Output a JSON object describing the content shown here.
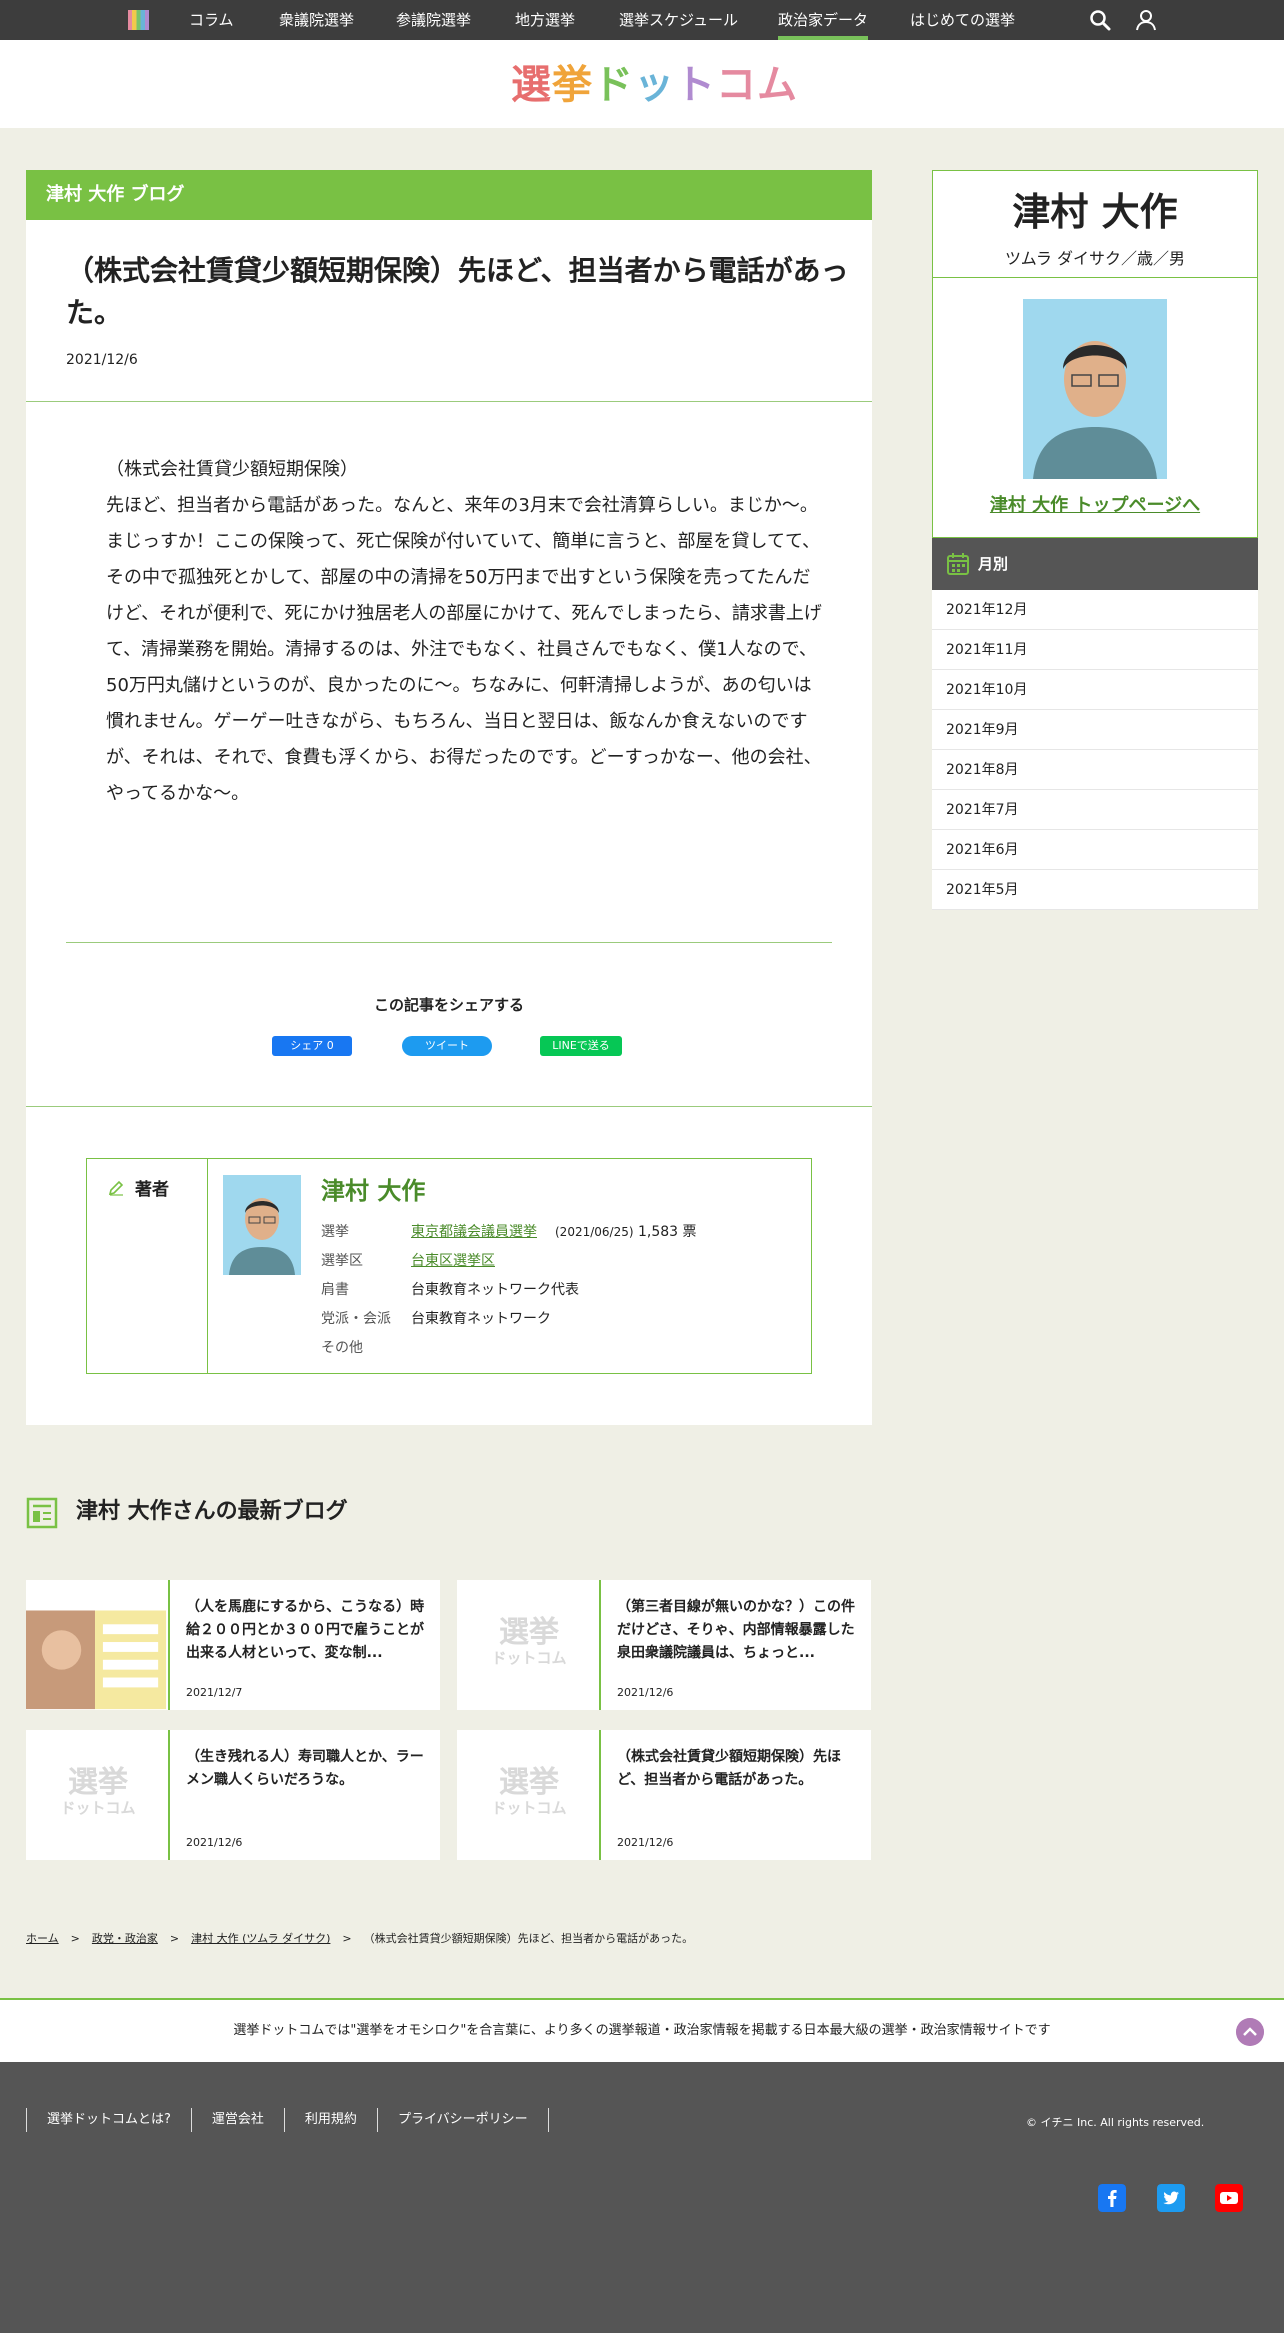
{
  "topnav": {
    "items": [
      "コラム",
      "衆議院選挙",
      "参議院選挙",
      "地方選挙",
      "選挙スケジュール",
      "政治家データ",
      "はじめての選挙"
    ],
    "active_index": 5,
    "accent_color": "#79c15a"
  },
  "logo": {
    "text": [
      "選",
      "挙",
      "ド",
      "ッ",
      "ト",
      "コム"
    ]
  },
  "article": {
    "header": "津村 大作 ブログ",
    "title": "（株式会社賃貸少額短期保険）先ほど、担当者から電話があった。",
    "date": "2021/12/6",
    "body": "（株式会社賃貸少額短期保険）\n先ほど、担当者から電話があった。なんと、来年の3月末で会社清算らしい。まじか～。まじっすか！ここの保険って、死亡保険が付いていて、簡単に言うと、部屋を貸してて、その中で孤独死とかして、部屋の中の清掃を50万円まで出すという保険を売ってたんだけど、それが便利で、死にかけ独居老人の部屋にかけて、死んでしまったら、請求書上げて、清掃業務を開始。清掃するのは、外注でもなく、社員さんでもなく、僕1人なので、50万円丸儲けというのが、良かったのに～。ちなみに、何軒清掃しようが、あの匂いは慣れません。ゲーゲー吐きながら、もちろん、当日と翌日は、飯なんか食えないのですが、それは、それで、食費も浮くから、お得だったのです。どーすっかなー、他の会社、やってるかな～。",
    "share_title": "この記事をシェアする",
    "share": {
      "fb": "シェア 0",
      "tw": "ツイート",
      "line": "LINEで送る"
    }
  },
  "author": {
    "label": "著者",
    "name": "津村 大作",
    "rows": {
      "election_key": "選挙",
      "election_link": "東京都議会議員選挙",
      "election_date": "(2021/06/25)",
      "election_votes": "1,583 票",
      "district_key": "選挙区",
      "district_link": "台東区選挙区",
      "title_key": "肩書",
      "title_val": "台東教育ネットワーク代表",
      "party_key": "党派・会派",
      "party_val": "台東教育ネットワーク",
      "other_key": "その他",
      "other_val": ""
    }
  },
  "profile": {
    "name": "津村 大作",
    "kana": "ツムラ ダイサク／歳／男",
    "top_link": "津村 大作 トップページへ"
  },
  "monthly": {
    "header": "月別",
    "items": [
      "2021年12月",
      "2021年11月",
      "2021年10月",
      "2021年9月",
      "2021年8月",
      "2021年7月",
      "2021年6月",
      "2021年5月"
    ]
  },
  "latest": {
    "title": "津村 大作さんの最新ブログ",
    "placeholder": [
      "選挙",
      "ドットコム"
    ],
    "cards": [
      {
        "title": "（人を馬鹿にするから、こうなる）時給２００円とか３００円で雇うことが出来る人材といって、変な制...",
        "date": "2021/12/7"
      },
      {
        "title": "（第三者目線が無いのかな？）この件だけどさ、そりゃ、内部情報暴露した泉田衆議院議員は、ちょっと...",
        "date": "2021/12/6"
      },
      {
        "title": "（生き残れる人）寿司職人とか、ラーメン職人くらいだろうな。",
        "date": "2021/12/6"
      },
      {
        "title": "（株式会社賃貸少額短期保険）先ほど、担当者から電話があった。",
        "date": "2021/12/6"
      }
    ]
  },
  "breadcrumb": [
    "ホーム",
    "政党・政治家",
    "津村 大作 (ツムラ ダイサク)",
    "（株式会社賃貸少額短期保険）先ほど、担当者から電話があった。"
  ],
  "tagline": "選挙ドットコムでは\"選挙をオモシロク\"を合言葉に、より多くの選挙報道・政治家情報を掲載する日本最大級の選挙・政治家情報サイトです",
  "footer": {
    "links": [
      "選挙ドットコムとは?",
      "運営会社",
      "利用規約",
      "プライバシーポリシー"
    ],
    "copyright": "© イチニ Inc. All rights reserved."
  },
  "colors": {
    "green": "#79c144",
    "dark": "#3d3d3d",
    "footer": "#555555",
    "link_green": "#4a8b2a"
  }
}
